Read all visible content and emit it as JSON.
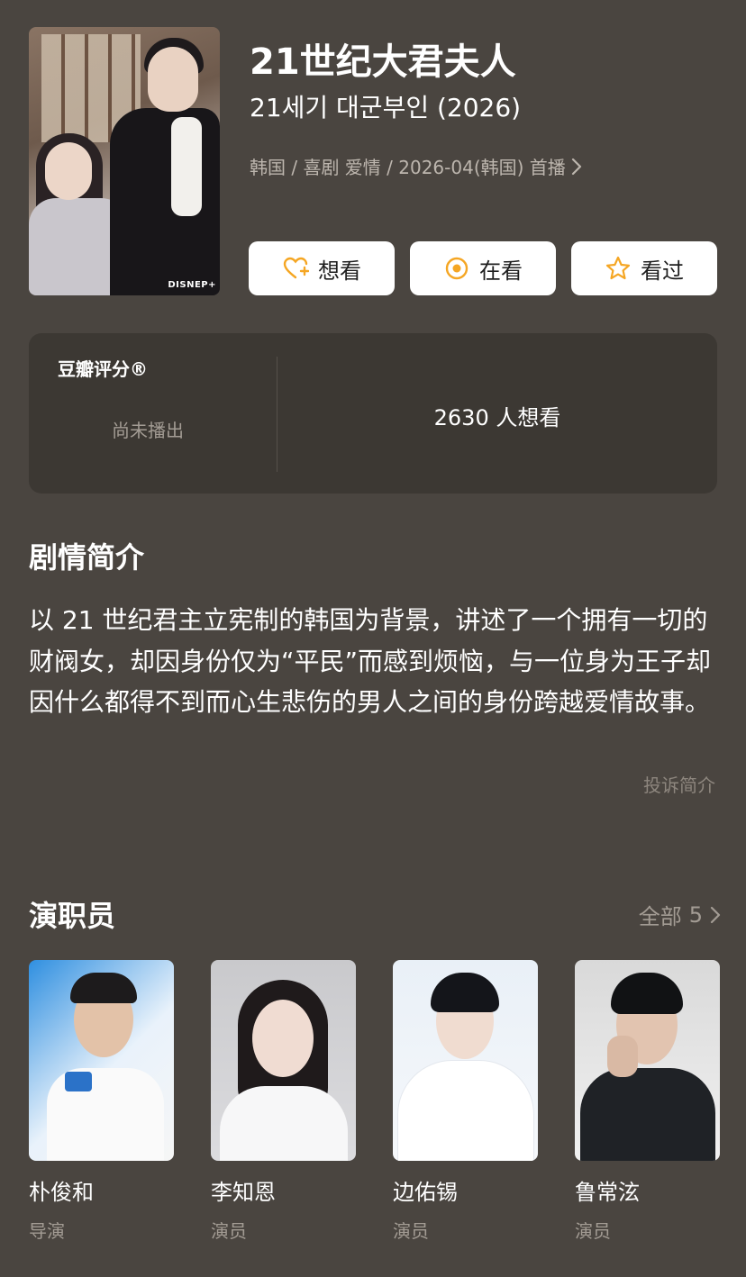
{
  "header": {
    "title": "21世纪大君夫人",
    "original_title": "21세기 대군부인 (2026)",
    "meta": "韩国 / 喜剧 爱情 / 2026-04(韩国) 首播",
    "poster_brand": "DISNEP+"
  },
  "actions": [
    {
      "label": "想看",
      "icon": "heart-plus-icon"
    },
    {
      "label": "在看",
      "icon": "target-icon"
    },
    {
      "label": "看过",
      "icon": "star-icon"
    }
  ],
  "rating": {
    "label": "豆瓣评分®",
    "status": "尚未播出",
    "want_count": "2630 人想看"
  },
  "synopsis": {
    "title": "剧情简介",
    "text": "以 21 世纪君主立宪制的韩国为背景，讲述了一个拥有一切的财阀女，却因身份仅为“平民”而感到烦恼，与一位身为王子却因什么都得不到而心生悲伤的男人之间的身份跨越爱情故事。",
    "report": "投诉简介"
  },
  "cast": {
    "title": "演职员",
    "all_label": "全部",
    "count": "5",
    "members": [
      {
        "name": "朴俊和",
        "role": "导演"
      },
      {
        "name": "李知恩",
        "role": "演员"
      },
      {
        "name": "边佑锡",
        "role": "演员"
      },
      {
        "name": "鲁常泫",
        "role": "演员"
      }
    ]
  },
  "colors": {
    "background": "#4a4540",
    "card": "#3c3833",
    "accent": "#f5a623"
  }
}
